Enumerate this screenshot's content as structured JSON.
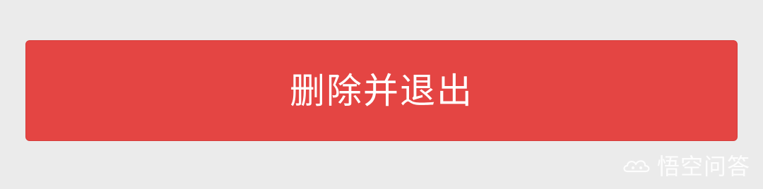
{
  "button": {
    "label": "删除并退出",
    "bg_color": "#e44543",
    "text_color": "#ffffff"
  },
  "page": {
    "bg_color": "#ebebeb"
  },
  "watermark": {
    "icon": "wukong-cloud-icon",
    "text": "悟空问答"
  }
}
